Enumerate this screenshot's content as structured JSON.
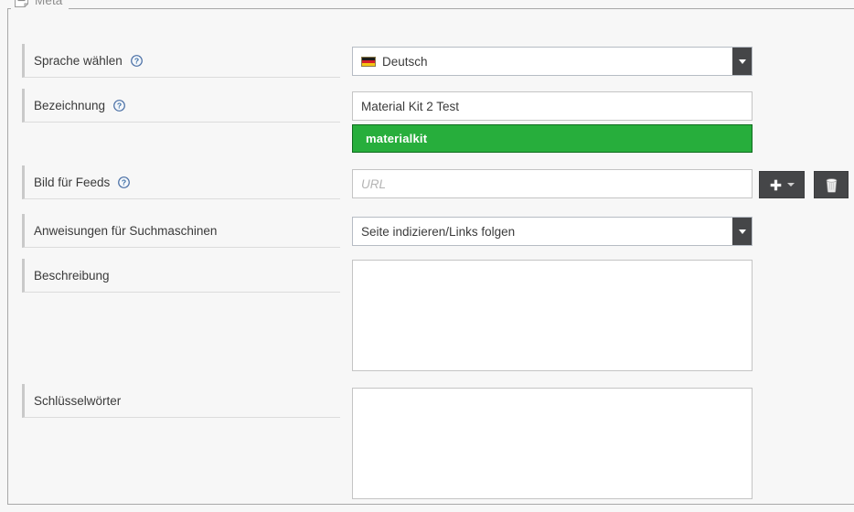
{
  "fieldset": {
    "legend": "Meta",
    "collapse_icon": "note-minus-icon"
  },
  "rows": [
    {
      "label": "Sprache wählen",
      "has_help": true,
      "control": "language-select",
      "value": "Deutsch",
      "icon": "flag-de-icon"
    },
    {
      "label": "Bezeichnung",
      "has_help": true,
      "control": "title-input",
      "value": "Material Kit 2 Test",
      "alias": "materialkit"
    },
    {
      "label": "Bild für Feeds",
      "has_help": true,
      "control": "feed-image-input",
      "placeholder": "URL",
      "buttons": [
        {
          "name": "add-media-button",
          "icon": "plus-icon",
          "caret": true
        },
        {
          "name": "delete-media-button",
          "icon": "trash-icon",
          "caret": false
        }
      ]
    },
    {
      "label": "Anweisungen für Suchmaschinen",
      "has_help": false,
      "control": "robots-select",
      "value": "Seite indizieren/Links folgen"
    },
    {
      "label": "Beschreibung",
      "has_help": false,
      "control": "description-textarea",
      "value": ""
    },
    {
      "label": "Schlüsselwörter",
      "has_help": false,
      "control": "keywords-textarea",
      "value": ""
    }
  ],
  "colors": {
    "page_background": "#f7f7f7",
    "alias_green": "#27ae3c",
    "alias_green_border": "#0e6b1d",
    "dark_button": "#454648",
    "label_accent": "#c9c9c9",
    "help_blue": "#3a6ea5"
  }
}
